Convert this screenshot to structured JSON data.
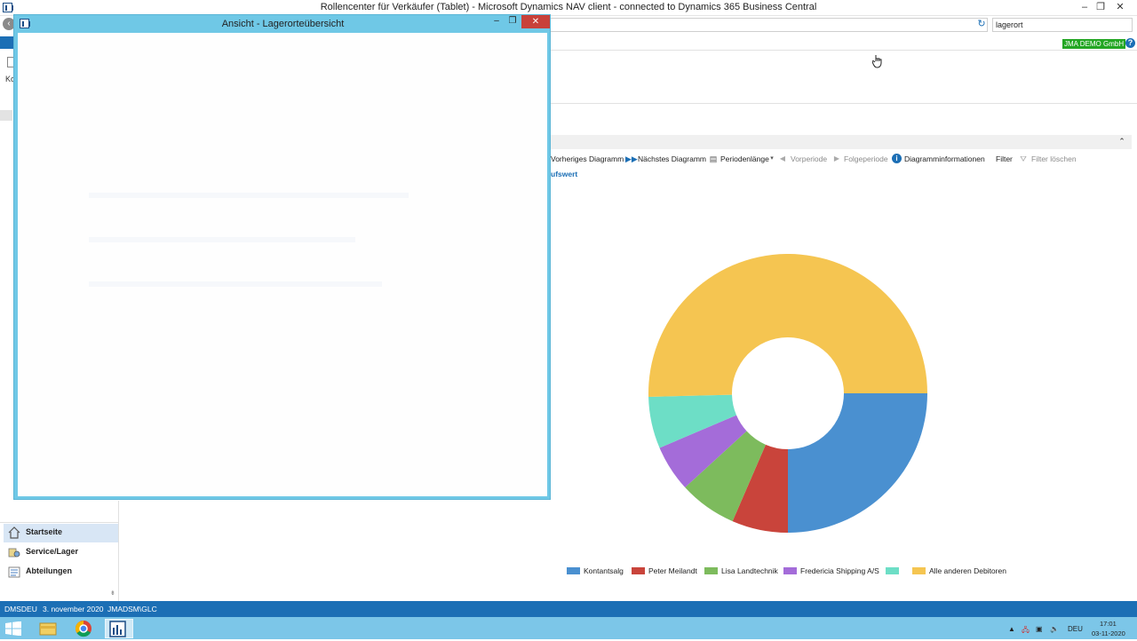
{
  "window": {
    "title": "Rollencenter für Verkäufer (Tablet) - Microsoft Dynamics NAV client - connected to Dynamics 365 Business Central",
    "minimize": "‒",
    "restore": "❐",
    "close": "✕"
  },
  "search": {
    "value": "lagerort"
  },
  "company": {
    "name": "JMA DEMO GmbH"
  },
  "nav_stub": {
    "label": "Ko"
  },
  "chart_toolbar": {
    "prev": "Vorheriges Diagramm",
    "next": "Nächstes Diagramm",
    "period_length": "Periodenlänge",
    "prev_period": "Vorperiode",
    "next_period": "Folgeperiode",
    "info": "Diagramminformationen",
    "filter": "Filter",
    "clear_filter": "Filter löschen"
  },
  "chart_link": "ufswert",
  "chart_data": {
    "type": "pie",
    "style": "donut",
    "legend_position": "bottom",
    "categories": [
      "Kontantsalg",
      "Peter Meilandt",
      "Lisa Landtechnik",
      "Fredericia Shipping A/S",
      "",
      "Alle anderen Debitoren"
    ],
    "values": [
      25.0,
      6.5,
      6.7,
      5.4,
      6.0,
      50.4
    ],
    "colors": [
      "#4a90d0",
      "#c9443b",
      "#7dbb5d",
      "#a46cd9",
      "#6ddec6",
      "#f5c551"
    ]
  },
  "modal": {
    "title": "Ansicht - Lagerorteübersicht",
    "minimize": "‒",
    "restore": "❐",
    "close": "✕"
  },
  "nav": {
    "items": [
      {
        "label": "Startseite",
        "icon": "home-icon",
        "active": true
      },
      {
        "label": "Service/Lager",
        "icon": "service-icon",
        "active": false
      },
      {
        "label": "Abteilungen",
        "icon": "departments-icon",
        "active": false
      }
    ]
  },
  "status": {
    "company": "DMSDEU",
    "date": "3. november 2020",
    "user": "JMADSM\\GLC"
  },
  "taskbar": {
    "lang": "DEU",
    "time": "17:01",
    "date": "03-11-2020"
  }
}
